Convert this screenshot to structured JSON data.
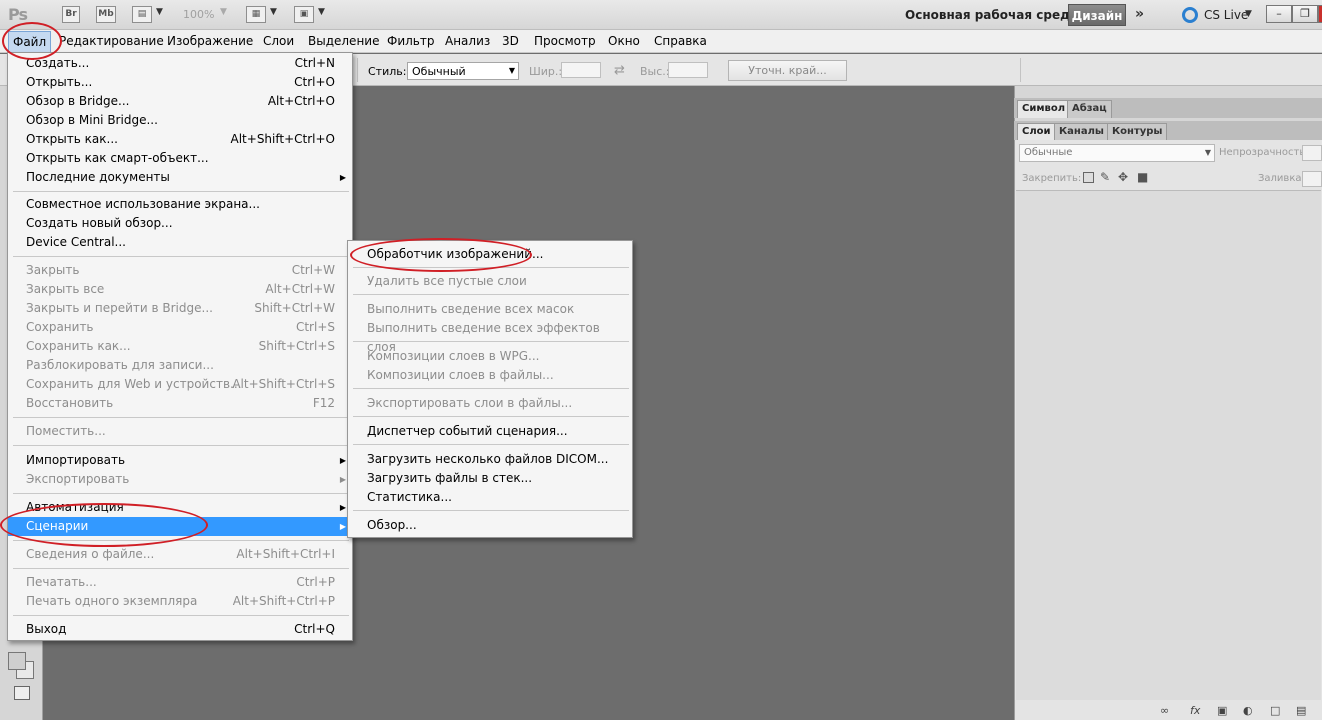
{
  "app": {
    "logo": "Ps",
    "btn_br": "Br",
    "btn_mb": "Mb",
    "zoom": "100%",
    "workspace_label": "Основная рабочая среда",
    "workspace_active": "Дизайн",
    "cslive": "CS Live"
  },
  "menubar": {
    "items": [
      "Файл",
      "Редактирование",
      "Изображение",
      "Слои",
      "Выделение",
      "Фильтр",
      "Анализ",
      "3D",
      "Просмотр",
      "Окно",
      "Справка"
    ]
  },
  "options": {
    "style_label": "Стиль:",
    "style_value": "Обычный",
    "width_label": "Шир.:",
    "height_label": "Выс.:",
    "refine_edge": "Уточн. край..."
  },
  "file_menu": {
    "items": [
      {
        "label": "Создать...",
        "shortcut": "Ctrl+N"
      },
      {
        "label": "Открыть...",
        "shortcut": "Ctrl+O"
      },
      {
        "label": "Обзор в Bridge...",
        "shortcut": "Alt+Ctrl+O"
      },
      {
        "label": "Обзор в Mini Bridge...",
        "shortcut": ""
      },
      {
        "label": "Открыть как...",
        "shortcut": "Alt+Shift+Ctrl+O"
      },
      {
        "label": "Открыть как смарт-объект...",
        "shortcut": ""
      },
      {
        "label": "Последние документы",
        "shortcut": ""
      },
      {
        "label": "Совместное использование экрана...",
        "shortcut": ""
      },
      {
        "label": "Создать новый обзор...",
        "shortcut": ""
      },
      {
        "label": "Device Central...",
        "shortcut": ""
      },
      {
        "label": "Закрыть",
        "shortcut": "Ctrl+W"
      },
      {
        "label": "Закрыть все",
        "shortcut": "Alt+Ctrl+W"
      },
      {
        "label": "Закрыть и перейти в Bridge...",
        "shortcut": "Shift+Ctrl+W"
      },
      {
        "label": "Сохранить",
        "shortcut": "Ctrl+S"
      },
      {
        "label": "Сохранить как...",
        "shortcut": "Shift+Ctrl+S"
      },
      {
        "label": "Разблокировать для записи...",
        "shortcut": ""
      },
      {
        "label": "Сохранить для Web и устройств...",
        "shortcut": "Alt+Shift+Ctrl+S"
      },
      {
        "label": "Восстановить",
        "shortcut": "F12"
      },
      {
        "label": "Поместить...",
        "shortcut": ""
      },
      {
        "label": "Импортировать",
        "shortcut": ""
      },
      {
        "label": "Экспортировать",
        "shortcut": ""
      },
      {
        "label": "Автоматизация",
        "shortcut": ""
      },
      {
        "label": "Сценарии",
        "shortcut": ""
      },
      {
        "label": "Сведения о файле...",
        "shortcut": "Alt+Shift+Ctrl+I"
      },
      {
        "label": "Печатать...",
        "shortcut": "Ctrl+P"
      },
      {
        "label": "Печать одного экземпляра",
        "shortcut": "Alt+Shift+Ctrl+P"
      },
      {
        "label": "Выход",
        "shortcut": "Ctrl+Q"
      }
    ]
  },
  "scripts_submenu": {
    "items": [
      "Обработчик изображений...",
      "Удалить все пустые слои",
      "Выполнить сведение всех масок",
      "Выполнить сведение всех эффектов слоя",
      "Композиции слоев в WPG...",
      "Композиции слоев в файлы...",
      "Экспортировать слои в файлы...",
      "Диспетчер событий сценария...",
      "Загрузить несколько файлов DICOM...",
      "Загрузить файлы в стек...",
      "Статистика...",
      "Обзор..."
    ]
  },
  "panels": {
    "top_tabs": [
      "Символ",
      "Абзац"
    ],
    "layer_tabs": [
      "Слои",
      "Каналы",
      "Контуры"
    ],
    "blend_mode": "Обычные",
    "opacity_label": "Непрозрачность:",
    "lock_label": "Закрепить:",
    "fill_label": "Заливка:"
  },
  "colors": {
    "highlight": "#3399ff",
    "annotation": "#d01f26",
    "canvas": "#6d6d6d"
  }
}
